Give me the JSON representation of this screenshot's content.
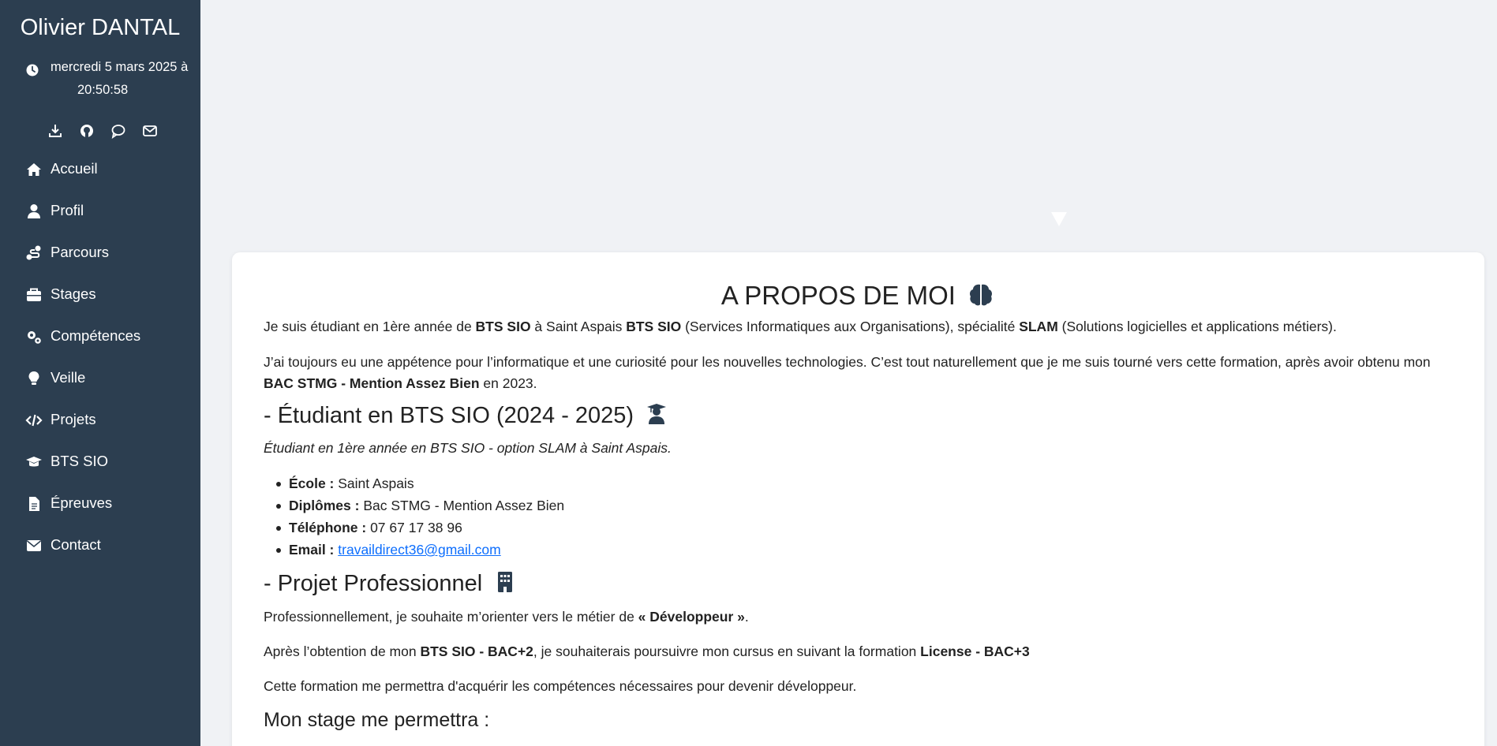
{
  "sidebar": {
    "brand": "Olivier DANTAL",
    "datetime_line1": "mercredi 5 mars 2025 à",
    "datetime_line2": "20:50:58",
    "social_icons": [
      "download-icon",
      "github-icon",
      "chat-icon",
      "mail-icon"
    ],
    "nav": [
      {
        "label": "Accueil",
        "icon": "home-icon"
      },
      {
        "label": "Profil",
        "icon": "user-icon"
      },
      {
        "label": "Parcours",
        "icon": "route-icon"
      },
      {
        "label": "Stages",
        "icon": "briefcase-icon"
      },
      {
        "label": "Compétences",
        "icon": "gears-icon"
      },
      {
        "label": "Veille",
        "icon": "lightbulb-icon"
      },
      {
        "label": "Projets",
        "icon": "code-icon"
      },
      {
        "label": "BTS SIO",
        "icon": "graduation-cap-icon"
      },
      {
        "label": "Épreuves",
        "icon": "file-icon"
      },
      {
        "label": "Contact",
        "icon": "envelope-icon"
      }
    ]
  },
  "main": {
    "title": "A PROPOS DE MOI",
    "intro": {
      "t1": "Je suis étudiant en 1ère année de ",
      "b1": "BTS SIO",
      "t2": " à Saint Aspais ",
      "b2": "BTS SIO",
      "t3": " (Services Informatiques aux Organisations), spécialité ",
      "b3": "SLAM",
      "t4": " (Solutions logicielles et applications métiers)."
    },
    "para2": {
      "line1": "J’ai toujours eu une appétence pour l’informatique et une curiosité pour les nouvelles technologies. C’est tout naturellement que je me suis tourné vers cette formation, après avoir obtenu mon",
      "b1": "BAC STMG - Mention Assez Bien",
      "t2": " en 2023."
    },
    "student_heading": "- Étudiant en BTS SIO (2024 - 2025)",
    "student_sub": "Étudiant en 1ère année en BTS SIO - option SLAM à Saint Aspais.",
    "info": [
      {
        "label": "École :",
        "value": " Saint Aspais"
      },
      {
        "label": "Diplômes :",
        "value": " Bac STMG - Mention Assez Bien"
      },
      {
        "label": "Téléphone :",
        "value": " 07 67 17 38 96"
      },
      {
        "label": "Email :",
        "value": "travaildirect36@gmail.com"
      }
    ],
    "project_heading": "- Projet Professionnel",
    "project_p1": {
      "t1": "Professionnellement, je souhaite m’orienter vers le métier de ",
      "b1": "« Développeur »",
      "t2": "."
    },
    "project_p2": {
      "t1": "Après l’obtention de mon ",
      "b1": "BTS SIO - BAC+2",
      "t2": ", je souhaiterais poursuivre mon cursus en suivant la formation ",
      "b2": "License - BAC+3"
    },
    "project_p3": "Cette formation me permettra d'acquérir les compétences nécessaires pour devenir développeur.",
    "stage_heading": "Mon stage me permettra :"
  },
  "colors": {
    "sidebar_bg": "#2c3e50",
    "page_bg": "#f0f2f5",
    "link": "#0d6efd"
  }
}
